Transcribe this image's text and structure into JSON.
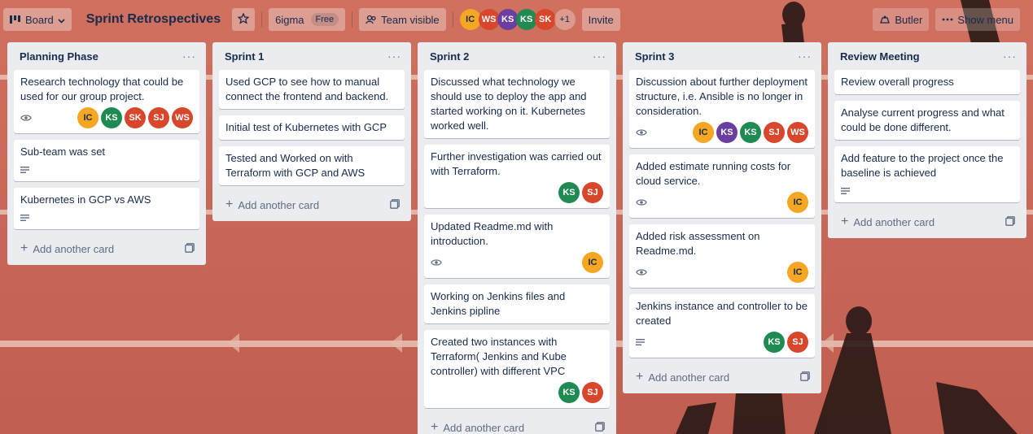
{
  "header": {
    "board_view_label": "Board",
    "board_title": "Sprint Retrospectives",
    "workspace_name": "6igma",
    "workspace_plan": "Free",
    "visibility_label": "Team visible",
    "members": [
      "IC",
      "WS",
      "KS",
      "KS",
      "SK"
    ],
    "members_more": "+1",
    "invite_label": "Invite",
    "butler_label": "Butler",
    "show_menu_label": "Show menu"
  },
  "lists": [
    {
      "title": "Planning Phase",
      "add_card_label": "Add another card",
      "cards": [
        {
          "text": "Research technology that could be used for our group project.",
          "badges": [
            "eye-icon"
          ],
          "members": [
            "IC",
            "KS",
            "SK",
            "SJ",
            "WS"
          ]
        },
        {
          "text": "Sub-team was set",
          "badges": [
            "description-icon"
          ],
          "members": []
        },
        {
          "text": "Kubernetes in GCP vs AWS",
          "badges": [
            "description-icon"
          ],
          "members": []
        }
      ]
    },
    {
      "title": "Sprint 1",
      "add_card_label": "Add another card",
      "cards": [
        {
          "text": "Used GCP to see how to manual connect the frontend and backend.",
          "badges": [],
          "members": []
        },
        {
          "text": "Initial test of Kubernetes with GCP",
          "badges": [],
          "members": []
        },
        {
          "text": "Tested and Worked on with Terraform with GCP and AWS",
          "badges": [],
          "members": []
        }
      ]
    },
    {
      "title": "Sprint 2",
      "add_card_label": "Add another card",
      "cards": [
        {
          "text": "Discussed what technology we should use to deploy the app and started working on it. Kubernetes worked well.",
          "badges": [],
          "members": []
        },
        {
          "text": "Further investigation was carried out with Terraform.",
          "badges": [],
          "members": [
            "KS",
            "SJ"
          ]
        },
        {
          "text": "Updated Readme.md with introduction.",
          "badges": [
            "eye-icon"
          ],
          "members": [
            "IC"
          ]
        },
        {
          "text": "Working on Jenkins files and Jenkins pipline",
          "badges": [],
          "members": []
        },
        {
          "text": "Created two instances with Terraform( Jenkins and Kube controller) with different VPC",
          "badges": [],
          "members": [
            "KS",
            "SJ"
          ]
        }
      ]
    },
    {
      "title": "Sprint 3",
      "add_card_label": "Add another card",
      "cards": [
        {
          "text": "Discussion about further deployment structure, i.e. Ansible is no longer in consideration.",
          "badges": [
            "eye-icon"
          ],
          "members": [
            "IC",
            "KS",
            "KS",
            "SJ",
            "WS"
          ]
        },
        {
          "text": "Added estimate running costs for cloud service.",
          "badges": [
            "eye-icon"
          ],
          "members": [
            "IC"
          ]
        },
        {
          "text": "Added risk assessment on Readme.md.",
          "badges": [
            "eye-icon"
          ],
          "members": [
            "IC"
          ]
        },
        {
          "text": "Jenkins instance and controller to be created",
          "badges": [
            "description-icon"
          ],
          "members": [
            "KS",
            "SJ"
          ]
        }
      ]
    },
    {
      "title": "Review Meeting",
      "add_card_label": "Add another card",
      "cards": [
        {
          "text": "Review overall progress",
          "badges": [],
          "members": []
        },
        {
          "text": "Analyse current progress and what could be done different.",
          "badges": [],
          "members": []
        },
        {
          "text": "Add feature to the project once the baseline is achieved",
          "badges": [
            "description-icon"
          ],
          "members": []
        }
      ]
    }
  ],
  "colors": {
    "track_red": "#c8695a",
    "list_bg": "#ebecf0",
    "avatar_orange": "#f5a623",
    "avatar_green": "#1f8a52",
    "avatar_red": "#d8462b",
    "avatar_purple": "#6b3fa0"
  }
}
